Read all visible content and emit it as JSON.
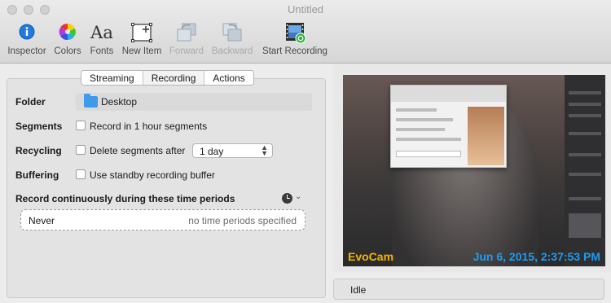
{
  "window": {
    "title": "Untitled"
  },
  "toolbar": {
    "items": [
      {
        "label": "Inspector",
        "icon": "info-icon",
        "enabled": true
      },
      {
        "label": "Colors",
        "icon": "color-wheel-icon",
        "enabled": true
      },
      {
        "label": "Fonts",
        "icon": "fonts-icon",
        "enabled": true
      },
      {
        "label": "New Item",
        "icon": "new-item-icon",
        "enabled": true
      },
      {
        "label": "Forward",
        "icon": "bring-forward-icon",
        "enabled": false
      },
      {
        "label": "Backward",
        "icon": "send-backward-icon",
        "enabled": false
      },
      {
        "label": "Start Recording",
        "icon": "record-film-icon",
        "enabled": true
      }
    ],
    "fonts_glyph": "Aa"
  },
  "tabs": [
    {
      "label": "Streaming",
      "active": false
    },
    {
      "label": "Recording",
      "active": true
    },
    {
      "label": "Actions",
      "active": false
    }
  ],
  "settings": {
    "folder": {
      "label": "Folder",
      "value": "Desktop",
      "icon": "folder-icon"
    },
    "segments": {
      "label": "Segments",
      "option": "Record in 1 hour segments",
      "checked": false
    },
    "recycling": {
      "label": "Recycling",
      "option": "Delete segments after",
      "checked": false,
      "selected": "1 day"
    },
    "buffering": {
      "label": "Buffering",
      "option": "Use standby recording buffer",
      "checked": false
    }
  },
  "periods": {
    "title": "Record continuously during these time periods",
    "mode": "Never",
    "summary": "no time periods specified"
  },
  "preview": {
    "brand": "EvoCam",
    "timestamp": "Jun 6, 2015, 2:37:53 PM"
  },
  "status": {
    "text": "Idle"
  },
  "colors": {
    "accent_blue": "#1e9cf0",
    "brand_yellow": "#f2b600",
    "folder_blue": "#3d9be9"
  }
}
